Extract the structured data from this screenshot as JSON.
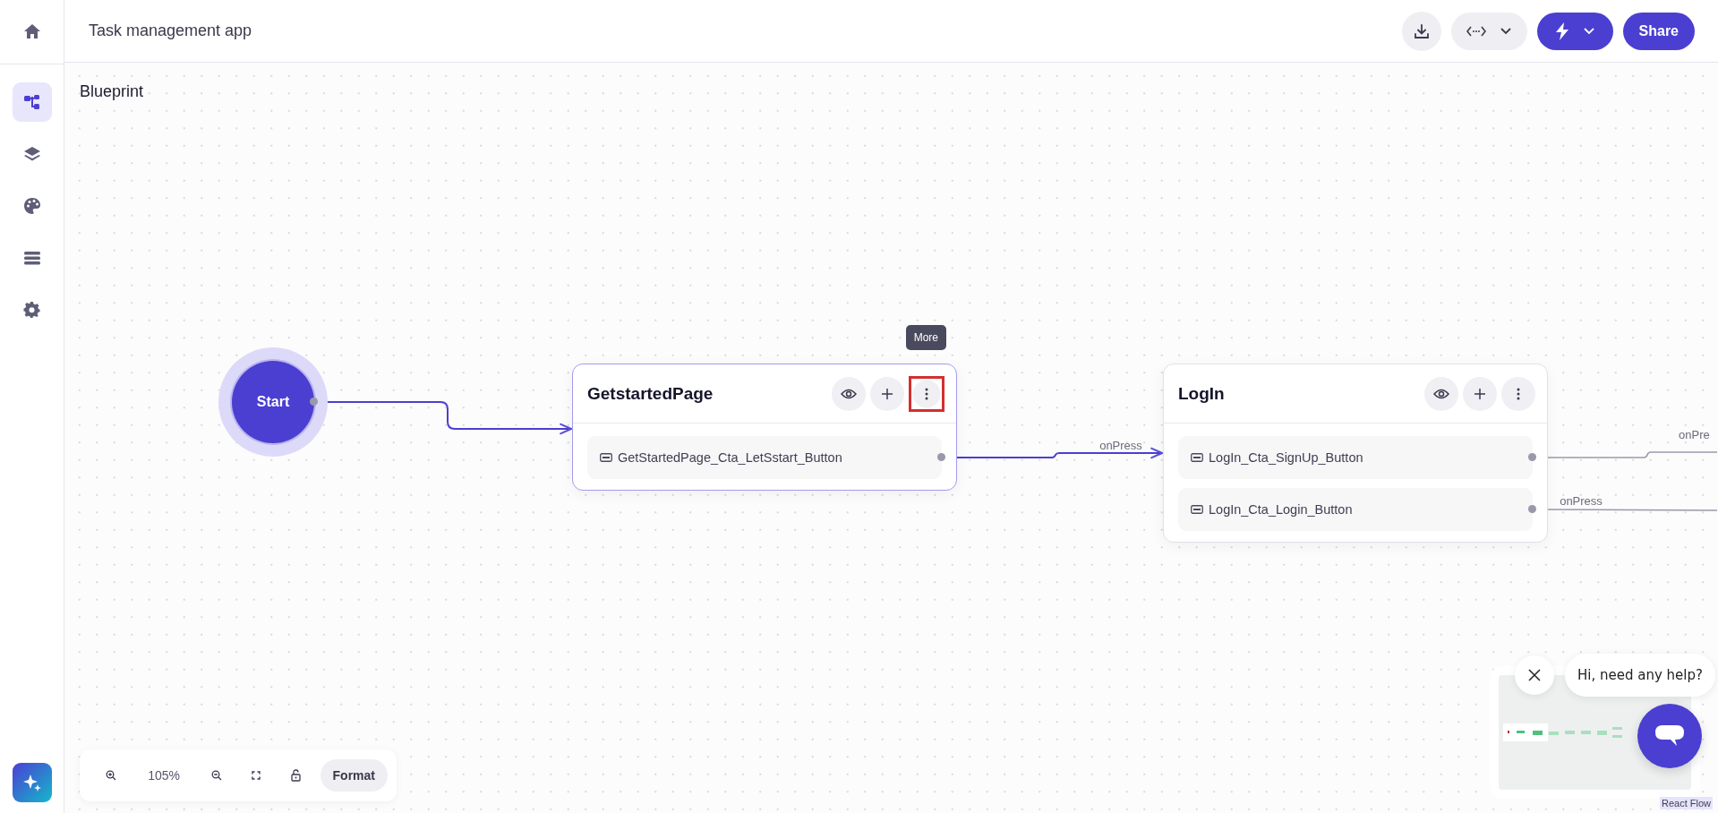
{
  "header": {
    "title": "Task management app",
    "share_label": "Share"
  },
  "sidebar": {
    "items": [
      {
        "kind": "home",
        "selected": false
      },
      {
        "kind": "flow",
        "selected": true
      },
      {
        "kind": "layers",
        "selected": false
      },
      {
        "kind": "palette",
        "selected": false
      },
      {
        "kind": "list",
        "selected": false
      },
      {
        "kind": "settings",
        "selected": false
      }
    ]
  },
  "canvas": {
    "title": "Blueprint",
    "nodes": [
      {
        "kind": "start",
        "label": "Start"
      },
      {
        "kind": "screen",
        "title": "GetstartedPage",
        "more_highlighted": true,
        "items": [
          "GetStartedPage_Cta_LetSstart_Button"
        ]
      },
      {
        "kind": "screen",
        "title": "LogIn",
        "more_highlighted": false,
        "items": [
          "LogIn_Cta_SignUp_Button",
          "LogIn_Cta_Login_Button"
        ]
      }
    ],
    "edges": [
      {
        "active": true
      },
      {
        "label": "onPress",
        "active": true
      },
      {
        "label": "onPre",
        "active": false
      },
      {
        "label": "onPress",
        "active": false
      }
    ],
    "tooltip": "More"
  },
  "controls": {
    "zoom": "105%",
    "format_label": "Format"
  },
  "chat": {
    "message": "Hi, need any help?"
  },
  "attribution": "React Flow"
}
